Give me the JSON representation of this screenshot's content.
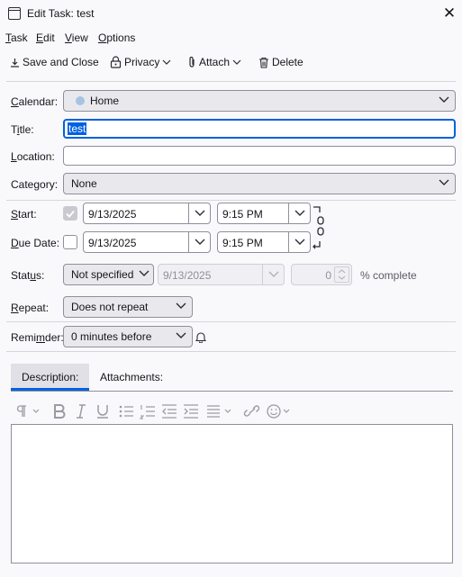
{
  "window": {
    "title": "Edit Task: test",
    "close_glyph": "✕"
  },
  "menu": [
    "Task",
    "Edit",
    "View",
    "Options"
  ],
  "toolbar": {
    "save_close": "Save and Close",
    "privacy": "Privacy",
    "attach": "Attach",
    "delete": "Delete"
  },
  "form": {
    "calendar": {
      "label": "Calendar:",
      "value": "Home",
      "dot_color": "#a7c3e2"
    },
    "title": {
      "label": "Title:",
      "value": "test"
    },
    "location": {
      "label": "Location:",
      "value": ""
    },
    "category": {
      "label": "Category:",
      "value": "None"
    },
    "start": {
      "label": "Start:",
      "checked": true,
      "date": "9/13/2025",
      "time": "9:15 PM"
    },
    "due": {
      "label": "Due Date:",
      "checked": false,
      "date": "9/13/2025",
      "time": "9:15 PM"
    },
    "status": {
      "label": "Status:",
      "value": "Not specified",
      "date": "9/13/2025",
      "percent": "0",
      "percent_label": "% complete"
    },
    "repeat": {
      "label": "Repeat:",
      "value": "Does not repeat"
    },
    "reminder": {
      "label": "Reminder:",
      "value": "0 minutes before"
    }
  },
  "tabs": {
    "description": "Description:",
    "attachments": "Attachments:"
  },
  "editor_toolbar": [
    "paragraph-icon",
    "bold-icon",
    "italic-icon",
    "underline-icon",
    "bullet-list-icon",
    "numbered-list-icon",
    "outdent-icon",
    "indent-icon",
    "align-icon",
    "link-icon",
    "emoji-icon"
  ],
  "colors": {
    "accent": "#0061e0",
    "border": "#8f8f9d",
    "button_bg": "#e9e9ed"
  }
}
